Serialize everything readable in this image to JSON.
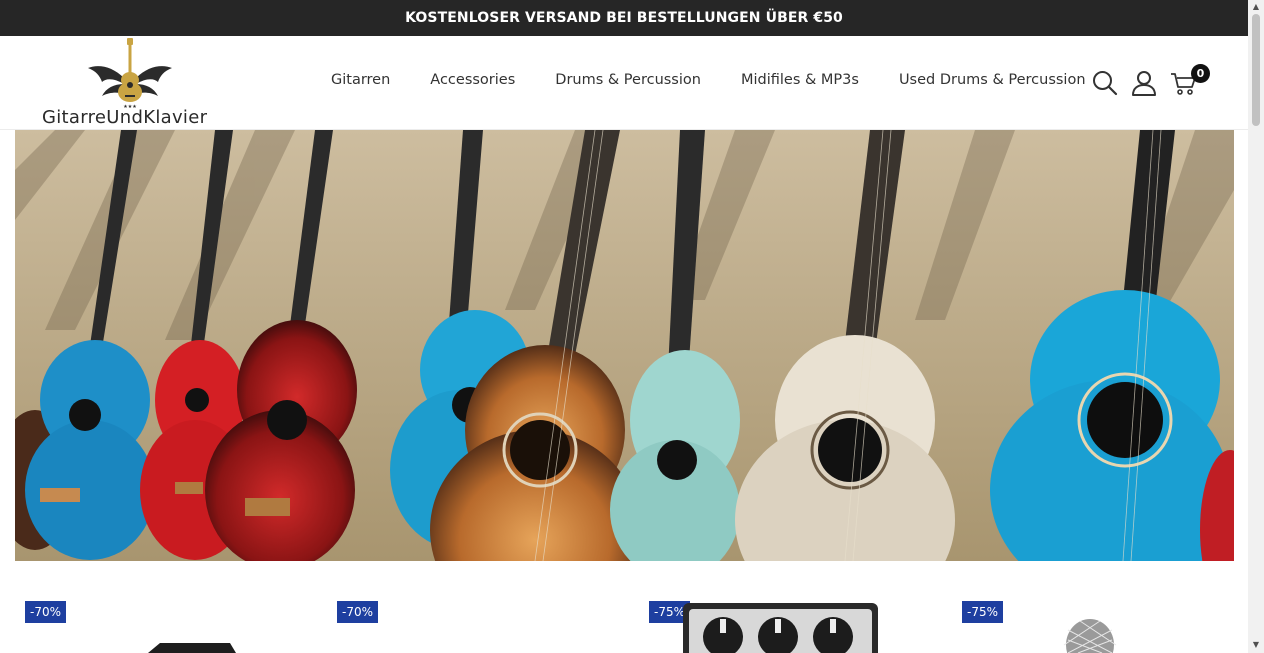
{
  "announcement": "KOSTENLOSER VERSAND BEI BESTELLUNGEN ÜBER €50",
  "logo": {
    "text": "GitarreUndKlavier"
  },
  "nav": {
    "items": [
      {
        "label": "Gitarren"
      },
      {
        "label": "Accessories"
      },
      {
        "label": "Drums & Percussion"
      },
      {
        "label": "Midifiles & MP3s"
      },
      {
        "label": "Used Drums & Percussion"
      }
    ]
  },
  "header_icons": {
    "search": "search-icon",
    "account": "user-icon",
    "cart": "cart-icon",
    "cart_count": "0"
  },
  "hero": {
    "image": "row of colorful acoustic guitars and ukuleles leaning against a wall"
  },
  "products": [
    {
      "discount": "-70%"
    },
    {
      "discount": "-70%"
    },
    {
      "discount": "-75%"
    },
    {
      "discount": "-75%"
    }
  ],
  "colors": {
    "topbar": "#262626",
    "badge": "#1e3fa0"
  }
}
